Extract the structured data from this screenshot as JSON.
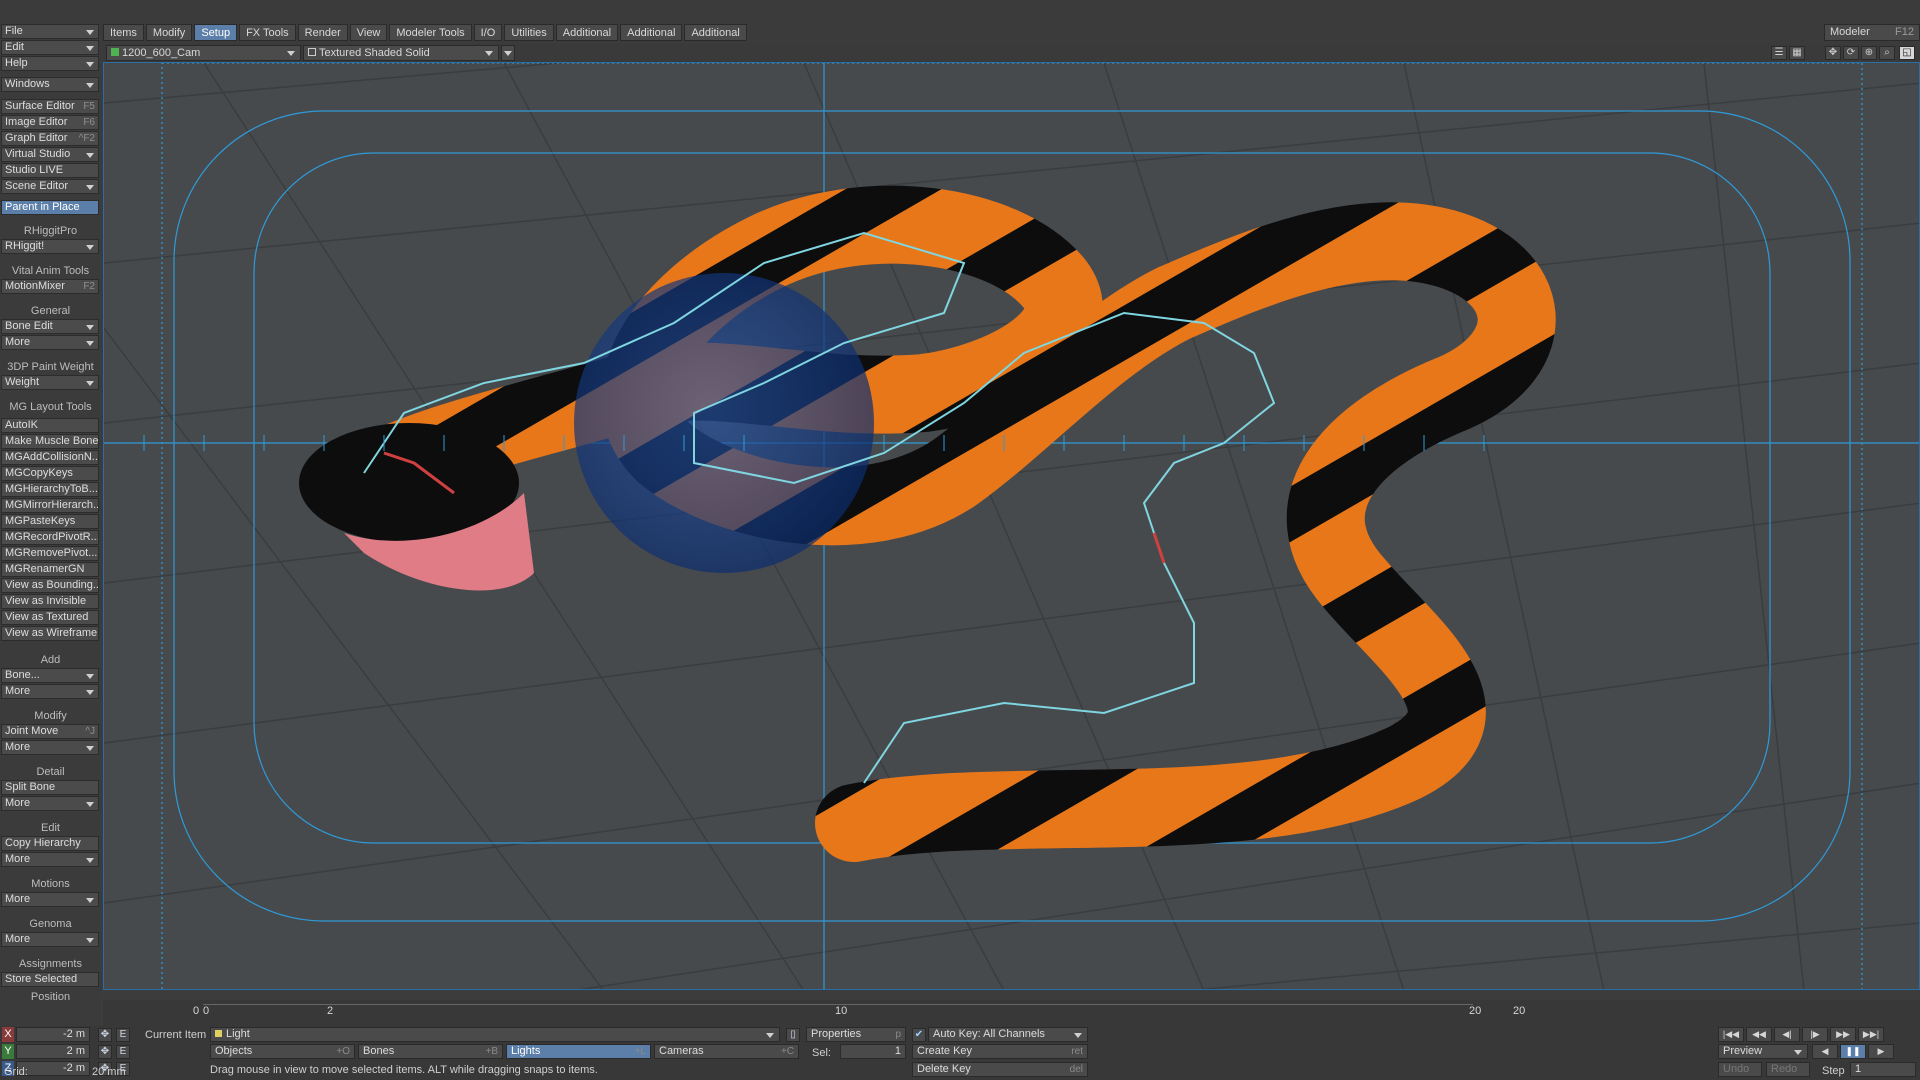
{
  "menu": {
    "tabs": [
      "Items",
      "Modify",
      "Setup",
      "FX Tools",
      "Render",
      "View",
      "Modeler Tools",
      "I/O",
      "Utilities",
      "Additional",
      "Additional",
      "Additional"
    ],
    "active_tab": "Setup",
    "modeler_label": "Modeler",
    "modeler_key": "F12"
  },
  "sidebar": {
    "file": "File",
    "edit": "Edit",
    "help": "Help",
    "windows": "Windows",
    "surface_editor": "Surface Editor",
    "surface_editor_key": "F5",
    "image_editor": "Image Editor",
    "image_editor_key": "F6",
    "graph_editor": "Graph Editor",
    "graph_editor_key": "^F2",
    "virtual_studio": "Virtual Studio",
    "studio_live": "Studio LIVE",
    "scene_editor": "Scene Editor",
    "parent_in_place": "Parent in Place",
    "rhiggitpro_head": "RHiggitPro",
    "rhiggit": "RHiggit!",
    "vital_head": "Vital Anim Tools",
    "motionmixer": "MotionMixer",
    "motionmixer_key": "F2",
    "general_head": "General",
    "bone_edit": "Bone Edit",
    "more": "More",
    "paint_head": "3DP Paint Weight",
    "weight": "Weight",
    "mg_head": "MG Layout Tools",
    "mg_items": [
      "AutoIK",
      "Make Muscle Bone",
      "MGAddCollisionN...",
      "MGCopyKeys",
      "MGHierarchyToB...",
      "MGMirrorHierarch...",
      "MGPasteKeys",
      "MGRecordPivotR...",
      "MGRemovePivot...",
      "MGRenamerGN",
      "View as Bounding...",
      "View as Invisible",
      "View as Textured",
      "View as Wireframe"
    ],
    "add_head": "Add",
    "bone": "Bone...",
    "modify_head": "Modify",
    "joint_move": "Joint Move",
    "joint_move_key": "^J",
    "detail_head": "Detail",
    "split_bone": "Split Bone",
    "edit_head": "Edit",
    "copy_hierarchy": "Copy Hierarchy",
    "motions_head": "Motions",
    "genoma_head": "Genoma",
    "assignments_head": "Assignments",
    "store_selected": "Store Selected",
    "position_head": "Position"
  },
  "viewport": {
    "camera": "1200_600_Cam",
    "shading": "Textured Shaded Solid"
  },
  "timeline": {
    "start": "0",
    "marks": [
      "0",
      "2",
      "10",
      "20"
    ],
    "end": "20"
  },
  "position": {
    "x_label": "X",
    "x_value": "-2 m",
    "y_label": "Y",
    "y_value": "2 m",
    "z_label": "Z",
    "z_value": "-2 m",
    "e": "E"
  },
  "grid": {
    "label": "Grid:",
    "value": "20 mm"
  },
  "bottom": {
    "current_item_label": "Current Item",
    "current_item": "Light",
    "objects": "Objects",
    "objects_key": "+O",
    "bones": "Bones",
    "bones_key": "+B",
    "lights": "Lights",
    "lights_key": "+L",
    "cameras": "Cameras",
    "cameras_key": "+C",
    "properties": "Properties",
    "properties_key": "p",
    "sel_label": "Sel:",
    "sel_value": "1",
    "auto_key": "Auto Key: All Channels",
    "create_key": "Create Key",
    "create_key_key": "ret",
    "delete_key": "Delete Key",
    "delete_key_key": "del",
    "preview": "Preview",
    "undo": "Undo",
    "redo": "Redo",
    "step_label": "Step",
    "step_value": "1",
    "status": "Drag mouse in view to move selected items. ALT while dragging snaps to items."
  },
  "colors": {
    "accent": "#5b7fa8",
    "snake_orange": "#e8771a",
    "snake_black": "#0d0d0d",
    "bone": "#7fd6e0",
    "safe_area": "#2f9ad8"
  }
}
